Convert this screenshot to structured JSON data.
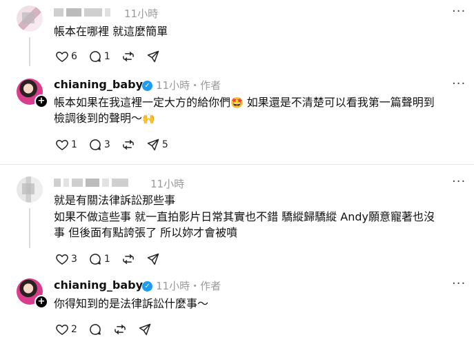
{
  "comments": [
    {
      "time": "11小時",
      "text": "帳本在哪裡 就這麼簡單",
      "likes": "6",
      "replies": "1",
      "reposts": "",
      "shares": ""
    },
    {
      "username": "chianing_baby",
      "time": "11小時",
      "author_tag": "作者",
      "line1": "帳本如果在我這裡一定大方的給你們",
      "line1_emoji": "🤩",
      "line1_rest": " 如果還是不清楚可以看我第一篇聲明到",
      "line2": "檢調後到的聲明～",
      "line2_emoji": "🙌",
      "likes": "1",
      "replies": "3",
      "reposts": "",
      "shares": "5"
    },
    {
      "time": "11小時",
      "line1": "就是有關法律訴訟那些事",
      "line2": "如果不做這些事 就一直拍影片日常其實也不錯 驕縱歸驕縱 Andy願意寵著也沒",
      "line3": "事 但後面有點誇張了 所以妳才會被噴",
      "likes": "3",
      "replies": "1",
      "reposts": "",
      "shares": ""
    },
    {
      "username": "chianing_baby",
      "time": "11小時",
      "author_tag": "作者",
      "text": "你得知到的是法律訴訟什麼事～",
      "likes": "2",
      "replies": "",
      "reposts": "",
      "shares": ""
    }
  ],
  "icons": {
    "like": "heart-icon",
    "reply": "comment-icon",
    "repost": "repost-icon",
    "share": "share-icon",
    "more": "more-dots-icon",
    "verified": "verified-badge-icon"
  },
  "colors": {
    "verified": "#1d9bf0",
    "muted": "#999999",
    "divider": "#e6e6e6"
  }
}
